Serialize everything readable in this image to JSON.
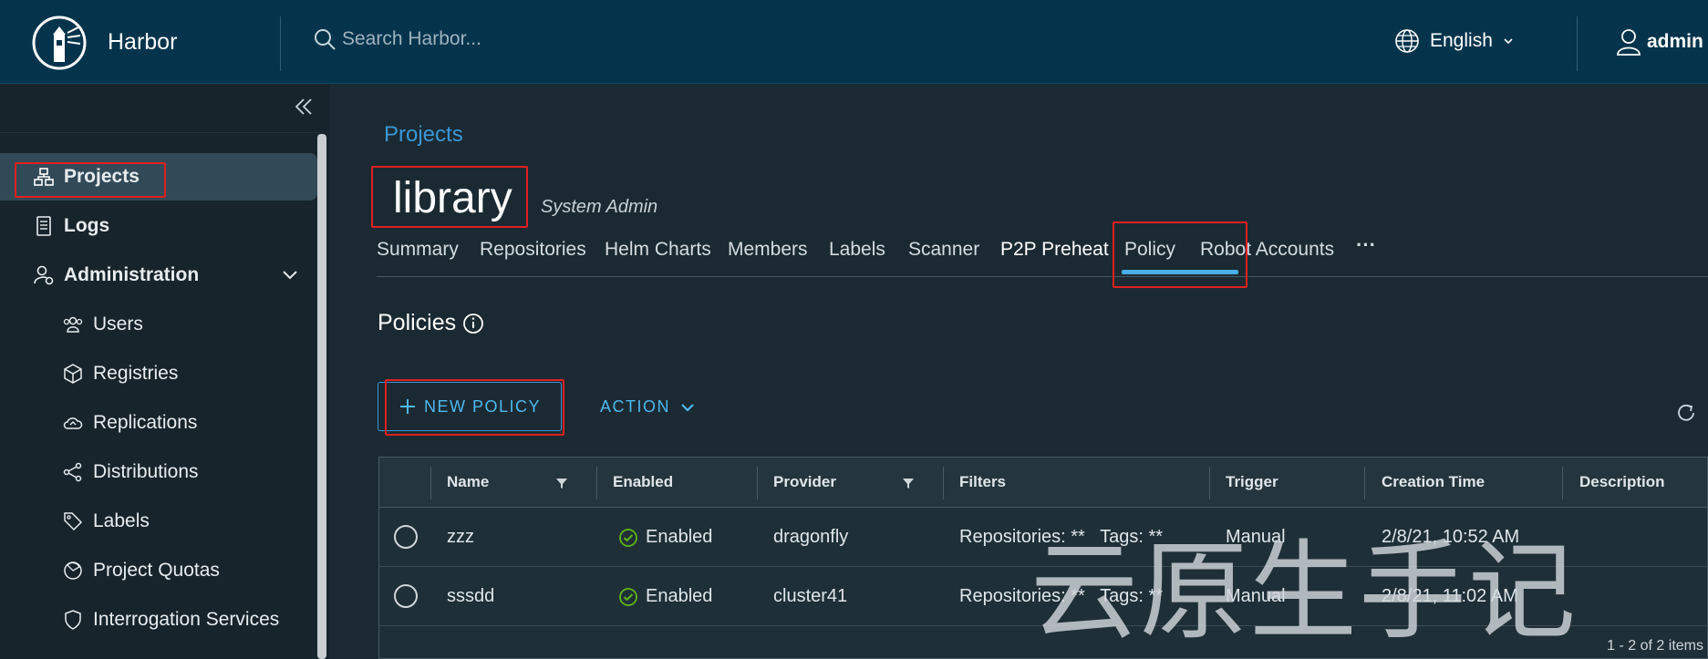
{
  "header": {
    "brand": "Harbor",
    "search_placeholder": "Search Harbor...",
    "language": "English",
    "user": "admin"
  },
  "sidebar": {
    "items": [
      {
        "label": "Projects",
        "icon": "projects-icon",
        "active": true
      },
      {
        "label": "Logs",
        "icon": "logs-icon"
      },
      {
        "label": "Administration",
        "icon": "administration-icon",
        "expanded": true
      },
      {
        "label": "Users",
        "icon": "users-icon"
      },
      {
        "label": "Registries",
        "icon": "registries-icon"
      },
      {
        "label": "Replications",
        "icon": "replications-icon"
      },
      {
        "label": "Distributions",
        "icon": "distributions-icon"
      },
      {
        "label": "Labels",
        "icon": "labels-icon"
      },
      {
        "label": "Project Quotas",
        "icon": "project-quotas-icon"
      },
      {
        "label": "Interrogation Services",
        "icon": "interrogation-services-icon"
      }
    ]
  },
  "main": {
    "breadcrumb": "Projects",
    "title": "library",
    "role": "System Admin",
    "tabs": [
      "Summary",
      "Repositories",
      "Helm Charts",
      "Members",
      "Labels",
      "Scanner",
      "P2P Preheat",
      "Policy",
      "Robot Accounts"
    ],
    "active_tab": "P2P Preheat",
    "more": "···",
    "section_title": "Policies",
    "new_policy": "NEW POLICY",
    "action": "ACTION"
  },
  "table": {
    "columns": [
      "Name",
      "Enabled",
      "Provider",
      "Filters",
      "Trigger",
      "Creation Time",
      "Description"
    ],
    "rows": [
      {
        "name": "zzz",
        "enabled": "Enabled",
        "provider": "dragonfly",
        "filters": "Repositories: **   Tags: **",
        "trigger": "Manual",
        "created": "2/8/21, 10:52 AM",
        "description": ""
      },
      {
        "name": "sssdd",
        "enabled": "Enabled",
        "provider": "cluster41",
        "filters": "Repositories: **   Tags: **",
        "trigger": "Manual",
        "created": "2/8/21, 11:02 AM",
        "description": ""
      }
    ],
    "footer": "1 - 2 of 2 items"
  },
  "watermark": "云原生手记",
  "colors": {
    "header_bg": "#03344c",
    "accent": "#49aeea",
    "highlight": "#e02020",
    "success": "#5eb715"
  }
}
